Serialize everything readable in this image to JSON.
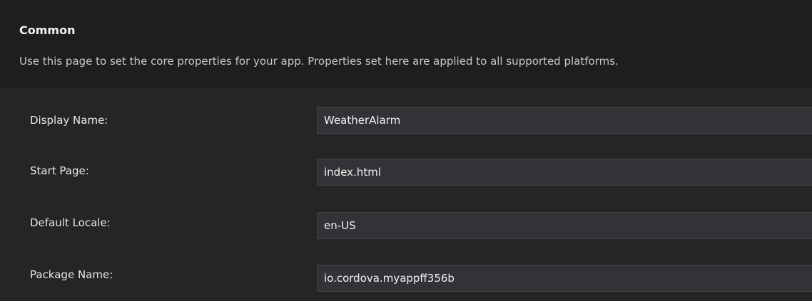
{
  "section": {
    "title": "Common",
    "description": "Use this page to set the core properties for your app. Properties set here are applied to all supported platforms."
  },
  "fields": [
    {
      "label": "Display Name:",
      "value": "WeatherAlarm"
    },
    {
      "label": "Start Page:",
      "value": "index.html"
    },
    {
      "label": "Default Locale:",
      "value": "en-US"
    },
    {
      "label": "Package Name:",
      "value": "io.cordova.myappff356b"
    }
  ],
  "colors": {
    "background": "#252526",
    "header_background": "#1e1e1e",
    "input_background": "#333337",
    "input_border": "#434346",
    "text": "#f1f1f1"
  }
}
